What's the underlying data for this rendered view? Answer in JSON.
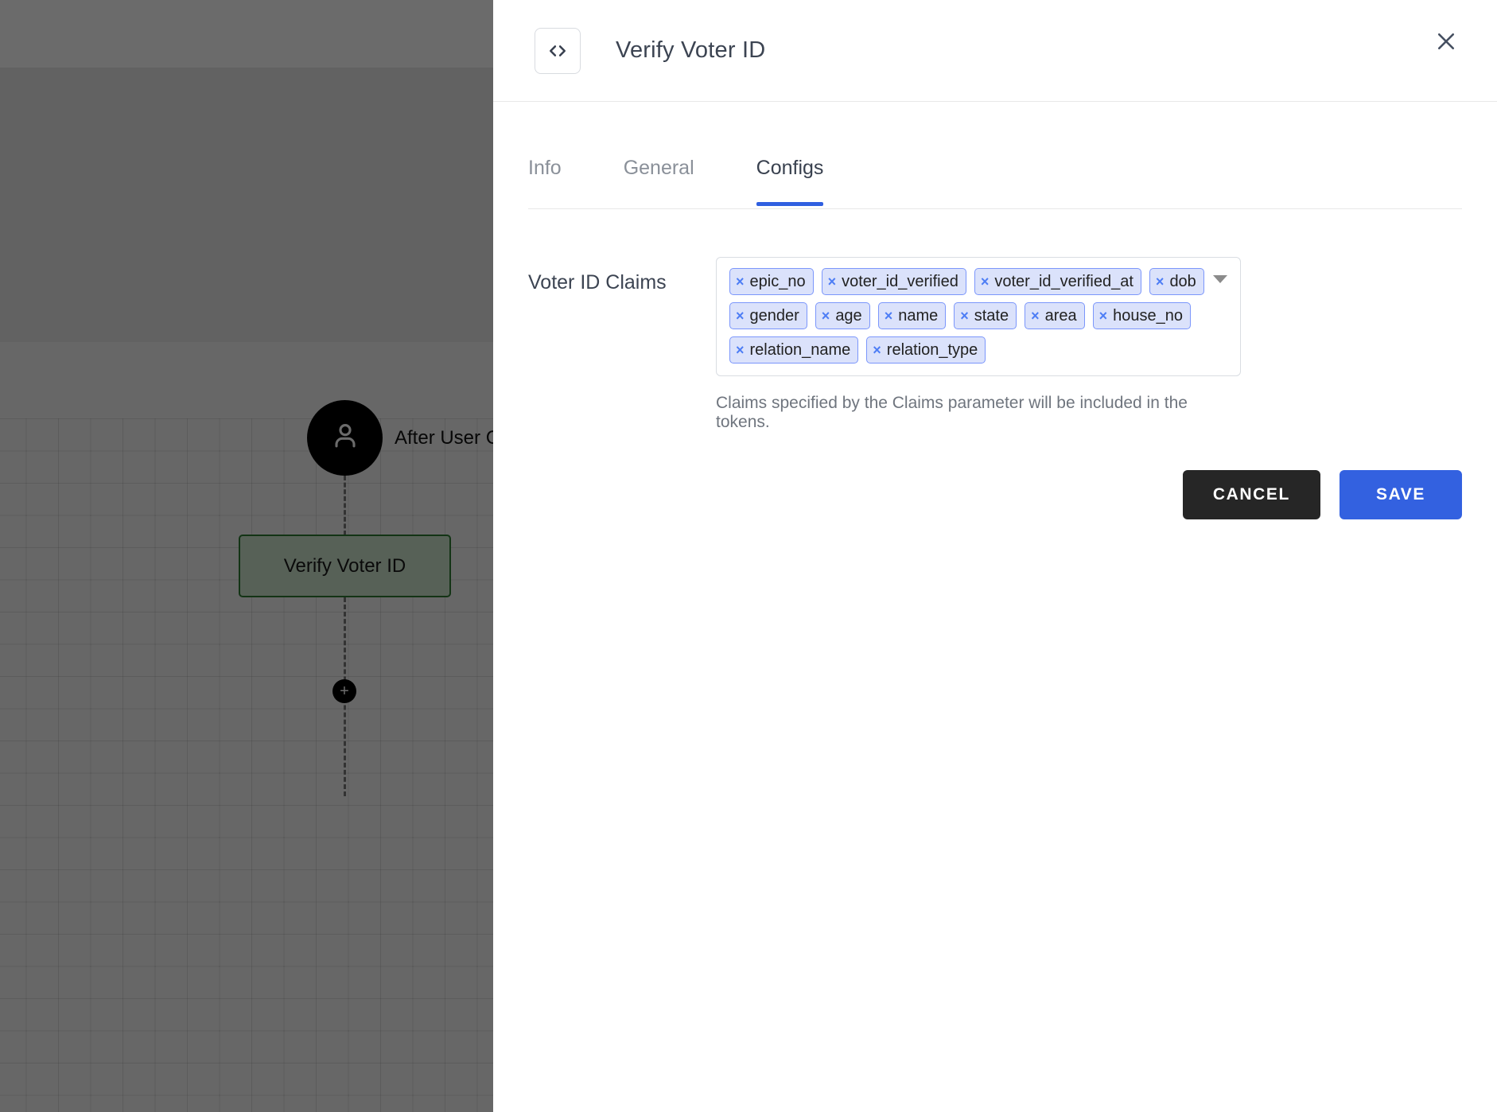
{
  "canvas": {
    "start_node": {
      "icon": "person-icon",
      "label": "After User Con"
    },
    "flow_node": {
      "label": "Verify Voter ID"
    },
    "add_button_label": "+"
  },
  "panel": {
    "header": {
      "icon": "code-brackets-icon",
      "title": "Verify Voter ID",
      "close_icon": "close-icon"
    },
    "tabs": [
      {
        "label": "Info",
        "active": false
      },
      {
        "label": "General",
        "active": false
      },
      {
        "label": "Configs",
        "active": true
      }
    ],
    "form": {
      "field_label": "Voter ID Claims",
      "chips": [
        "epic_no",
        "voter_id_verified",
        "voter_id_verified_at",
        "dob",
        "gender",
        "age",
        "name",
        "state",
        "area",
        "house_no",
        "relation_name",
        "relation_type"
      ],
      "chip_remove_glyph": "×",
      "dropdown_icon": "chevron-down-icon",
      "helper_text": "Claims specified by the Claims parameter will be included in the tokens."
    },
    "actions": {
      "cancel_label": "CANCEL",
      "save_label": "SAVE"
    }
  },
  "colors": {
    "accent_blue": "#3361e0",
    "chip_bg": "#dbe2fb",
    "chip_border": "#7b96fb",
    "chip_x": "#4d7df5",
    "cancel_bg": "#262626",
    "node_green_border": "#2e7d32"
  }
}
